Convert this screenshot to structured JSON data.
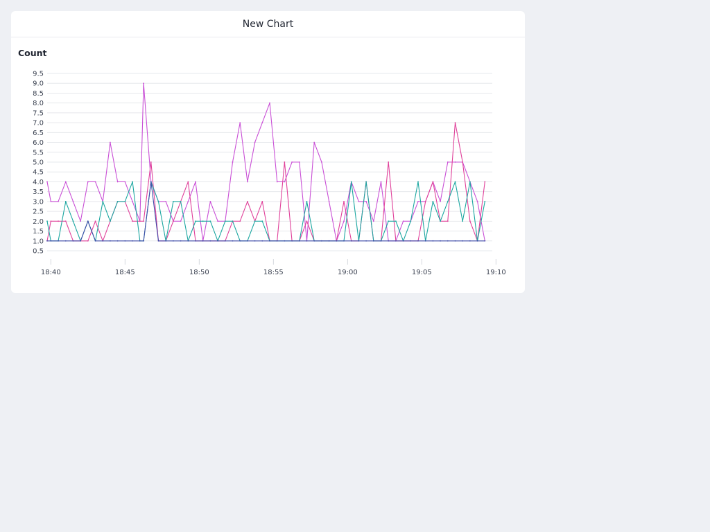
{
  "card": {
    "title": "New Chart"
  },
  "chart_data": {
    "type": "line",
    "title": "New Chart",
    "ylabel": "Count",
    "xlabel": "",
    "ylim": [
      0.5,
      9.5
    ],
    "yticks": [
      "0.5",
      "1.0",
      "1.5",
      "2.0",
      "2.5",
      "3.0",
      "3.5",
      "4.0",
      "4.5",
      "5.0",
      "5.5",
      "6.0",
      "6.5",
      "7.0",
      "7.5",
      "8.0",
      "8.5",
      "9.0",
      "9.5"
    ],
    "xlim": [
      "18:39:45",
      "19:09:45"
    ],
    "xticks": [
      "18:40",
      "18:45",
      "18:50",
      "18:55",
      "19:00",
      "19:05",
      "19:10"
    ],
    "grid": true,
    "x_time_format": "HH:MM",
    "series": [
      {
        "color": "#c94fd6",
        "points": [
          [
            "18:39:45",
            4
          ],
          [
            "18:40:00",
            3
          ],
          [
            "18:40:30",
            3
          ],
          [
            "18:41:00",
            4
          ],
          [
            "18:41:30",
            3
          ],
          [
            "18:42:00",
            2
          ],
          [
            "18:42:30",
            4
          ],
          [
            "18:43:00",
            4
          ],
          [
            "18:43:30",
            3
          ],
          [
            "18:44:00",
            6
          ],
          [
            "18:44:30",
            4
          ],
          [
            "18:45:00",
            4
          ],
          [
            "18:45:30",
            3
          ],
          [
            "18:46:00",
            2
          ],
          [
            "18:46:15",
            9
          ],
          [
            "18:46:45",
            4
          ],
          [
            "18:47:15",
            3
          ],
          [
            "18:47:45",
            3
          ],
          [
            "18:48:15",
            2
          ],
          [
            "18:48:45",
            2
          ],
          [
            "18:49:15",
            3
          ],
          [
            "18:49:45",
            4
          ],
          [
            "18:50:15",
            1
          ],
          [
            "18:50:45",
            3
          ],
          [
            "18:51:15",
            2
          ],
          [
            "18:51:45",
            2
          ],
          [
            "18:52:15",
            5
          ],
          [
            "18:52:45",
            7
          ],
          [
            "18:53:15",
            4
          ],
          [
            "18:53:45",
            6
          ],
          [
            "18:54:15",
            7
          ],
          [
            "18:54:45",
            8
          ],
          [
            "18:55:15",
            4
          ],
          [
            "18:55:45",
            4
          ],
          [
            "18:56:15",
            5
          ],
          [
            "18:56:45",
            5
          ],
          [
            "18:57:15",
            1
          ],
          [
            "18:57:45",
            6
          ],
          [
            "18:58:15",
            5
          ],
          [
            "18:58:45",
            3
          ],
          [
            "18:59:15",
            1
          ],
          [
            "18:59:45",
            2
          ],
          [
            "19:00:15",
            4
          ],
          [
            "19:00:45",
            3
          ],
          [
            "19:01:15",
            3
          ],
          [
            "19:01:45",
            2
          ],
          [
            "19:02:15",
            4
          ],
          [
            "19:02:45",
            1
          ],
          [
            "19:03:15",
            1
          ],
          [
            "19:03:45",
            2
          ],
          [
            "19:04:15",
            2
          ],
          [
            "19:04:45",
            3
          ],
          [
            "19:05:15",
            3
          ],
          [
            "19:05:45",
            4
          ],
          [
            "19:06:15",
            3
          ],
          [
            "19:06:45",
            5
          ],
          [
            "19:07:15",
            5
          ],
          [
            "19:07:45",
            5
          ],
          [
            "19:08:15",
            4
          ],
          [
            "19:08:45",
            3
          ],
          [
            "19:09:15",
            1
          ]
        ]
      },
      {
        "color": "#e0409a",
        "points": [
          [
            "18:39:45",
            1
          ],
          [
            "18:40:00",
            2
          ],
          [
            "18:40:30",
            2
          ],
          [
            "18:41:00",
            2
          ],
          [
            "18:41:30",
            1
          ],
          [
            "18:42:00",
            1
          ],
          [
            "18:42:30",
            1
          ],
          [
            "18:43:00",
            2
          ],
          [
            "18:43:30",
            1
          ],
          [
            "18:44:00",
            2
          ],
          [
            "18:44:30",
            3
          ],
          [
            "18:45:00",
            3
          ],
          [
            "18:45:30",
            2
          ],
          [
            "18:46:00",
            2
          ],
          [
            "18:46:15",
            2
          ],
          [
            "18:46:45",
            5
          ],
          [
            "18:47:15",
            1
          ],
          [
            "18:47:45",
            1
          ],
          [
            "18:48:15",
            2
          ],
          [
            "18:48:45",
            3
          ],
          [
            "18:49:15",
            4
          ],
          [
            "18:49:45",
            1
          ],
          [
            "18:50:15",
            1
          ],
          [
            "18:50:45",
            1
          ],
          [
            "18:51:15",
            1
          ],
          [
            "18:51:45",
            1
          ],
          [
            "18:52:15",
            2
          ],
          [
            "18:52:45",
            2
          ],
          [
            "18:53:15",
            3
          ],
          [
            "18:53:45",
            2
          ],
          [
            "18:54:15",
            3
          ],
          [
            "18:54:45",
            1
          ],
          [
            "18:55:15",
            1
          ],
          [
            "18:55:45",
            5
          ],
          [
            "18:56:15",
            1
          ],
          [
            "18:56:45",
            1
          ],
          [
            "18:57:15",
            2
          ],
          [
            "18:57:45",
            1
          ],
          [
            "18:58:15",
            1
          ],
          [
            "18:58:45",
            1
          ],
          [
            "18:59:15",
            1
          ],
          [
            "18:59:45",
            3
          ],
          [
            "19:00:15",
            1
          ],
          [
            "19:00:45",
            1
          ],
          [
            "19:01:15",
            4
          ],
          [
            "19:01:45",
            1
          ],
          [
            "19:02:15",
            1
          ],
          [
            "19:02:45",
            5
          ],
          [
            "19:03:15",
            1
          ],
          [
            "19:03:45",
            1
          ],
          [
            "19:04:15",
            1
          ],
          [
            "19:04:45",
            1
          ],
          [
            "19:05:15",
            3
          ],
          [
            "19:05:45",
            4
          ],
          [
            "19:06:15",
            2
          ],
          [
            "19:06:45",
            2
          ],
          [
            "19:07:15",
            7
          ],
          [
            "19:07:45",
            5
          ],
          [
            "19:08:15",
            2
          ],
          [
            "19:08:45",
            1
          ],
          [
            "19:09:15",
            4
          ]
        ]
      },
      {
        "color": "#1aa6a0",
        "points": [
          [
            "18:39:45",
            2
          ],
          [
            "18:40:00",
            1
          ],
          [
            "18:40:30",
            1
          ],
          [
            "18:41:00",
            3
          ],
          [
            "18:41:30",
            2
          ],
          [
            "18:42:00",
            1
          ],
          [
            "18:42:30",
            2
          ],
          [
            "18:43:00",
            1
          ],
          [
            "18:43:30",
            3
          ],
          [
            "18:44:00",
            2
          ],
          [
            "18:44:30",
            3
          ],
          [
            "18:45:00",
            3
          ],
          [
            "18:45:30",
            4
          ],
          [
            "18:46:00",
            1
          ],
          [
            "18:46:15",
            1
          ],
          [
            "18:46:45",
            4
          ],
          [
            "18:47:15",
            3
          ],
          [
            "18:47:45",
            1
          ],
          [
            "18:48:15",
            3
          ],
          [
            "18:48:45",
            3
          ],
          [
            "18:49:15",
            1
          ],
          [
            "18:49:45",
            2
          ],
          [
            "18:50:15",
            2
          ],
          [
            "18:50:45",
            2
          ],
          [
            "18:51:15",
            1
          ],
          [
            "18:51:45",
            2
          ],
          [
            "18:52:15",
            2
          ],
          [
            "18:52:45",
            1
          ],
          [
            "18:53:15",
            1
          ],
          [
            "18:53:45",
            2
          ],
          [
            "18:54:15",
            2
          ],
          [
            "18:54:45",
            1
          ],
          [
            "18:55:15",
            1
          ],
          [
            "18:55:45",
            1
          ],
          [
            "18:56:15",
            1
          ],
          [
            "18:56:45",
            1
          ],
          [
            "18:57:15",
            3
          ],
          [
            "18:57:45",
            1
          ],
          [
            "18:58:15",
            1
          ],
          [
            "18:58:45",
            1
          ],
          [
            "18:59:15",
            1
          ],
          [
            "18:59:45",
            1
          ],
          [
            "19:00:15",
            4
          ],
          [
            "19:00:45",
            1
          ],
          [
            "19:01:15",
            4
          ],
          [
            "19:01:45",
            1
          ],
          [
            "19:02:15",
            1
          ],
          [
            "19:02:45",
            2
          ],
          [
            "19:03:15",
            2
          ],
          [
            "19:03:45",
            1
          ],
          [
            "19:04:15",
            2
          ],
          [
            "19:04:45",
            4
          ],
          [
            "19:05:15",
            1
          ],
          [
            "19:05:45",
            3
          ],
          [
            "19:06:15",
            2
          ],
          [
            "19:06:45",
            3
          ],
          [
            "19:07:15",
            4
          ],
          [
            "19:07:45",
            2
          ],
          [
            "19:08:15",
            4
          ],
          [
            "19:08:45",
            1
          ],
          [
            "19:09:15",
            3
          ]
        ]
      },
      {
        "color": "#3d4aa8",
        "points": [
          [
            "18:39:45",
            1
          ],
          [
            "18:40:00",
            1
          ],
          [
            "18:40:30",
            1
          ],
          [
            "18:41:00",
            1
          ],
          [
            "18:41:30",
            1
          ],
          [
            "18:42:00",
            1
          ],
          [
            "18:42:30",
            2
          ],
          [
            "18:43:00",
            1
          ],
          [
            "18:43:30",
            1
          ],
          [
            "18:44:00",
            1
          ],
          [
            "18:44:30",
            1
          ],
          [
            "18:45:00",
            1
          ],
          [
            "18:45:30",
            1
          ],
          [
            "18:46:00",
            1
          ],
          [
            "18:46:15",
            1
          ],
          [
            "18:46:45",
            4
          ],
          [
            "18:47:15",
            1
          ],
          [
            "18:47:45",
            1
          ],
          [
            "18:48:15",
            1
          ],
          [
            "18:48:45",
            1
          ],
          [
            "18:49:15",
            1
          ],
          [
            "18:49:45",
            1
          ],
          [
            "18:50:15",
            1
          ],
          [
            "18:50:45",
            1
          ],
          [
            "18:51:15",
            1
          ],
          [
            "18:51:45",
            1
          ],
          [
            "18:52:15",
            1
          ],
          [
            "18:52:45",
            1
          ],
          [
            "18:53:15",
            1
          ],
          [
            "18:53:45",
            1
          ],
          [
            "18:54:15",
            1
          ],
          [
            "18:54:45",
            1
          ],
          [
            "18:55:15",
            1
          ],
          [
            "18:55:45",
            1
          ],
          [
            "18:56:15",
            1
          ],
          [
            "18:56:45",
            1
          ],
          [
            "18:57:15",
            1
          ],
          [
            "18:57:45",
            1
          ],
          [
            "18:58:15",
            1
          ],
          [
            "18:58:45",
            1
          ],
          [
            "18:59:15",
            1
          ],
          [
            "18:59:45",
            1
          ],
          [
            "19:00:15",
            1
          ],
          [
            "19:00:45",
            1
          ],
          [
            "19:01:15",
            1
          ],
          [
            "19:01:45",
            1
          ],
          [
            "19:02:15",
            1
          ],
          [
            "19:02:45",
            1
          ],
          [
            "19:03:15",
            1
          ],
          [
            "19:03:45",
            1
          ],
          [
            "19:04:15",
            1
          ],
          [
            "19:04:45",
            1
          ],
          [
            "19:05:15",
            1
          ],
          [
            "19:05:45",
            1
          ],
          [
            "19:06:15",
            1
          ],
          [
            "19:06:45",
            1
          ],
          [
            "19:07:15",
            1
          ],
          [
            "19:07:45",
            1
          ],
          [
            "19:08:15",
            1
          ],
          [
            "19:08:45",
            1
          ],
          [
            "19:09:15",
            1
          ]
        ]
      }
    ]
  }
}
